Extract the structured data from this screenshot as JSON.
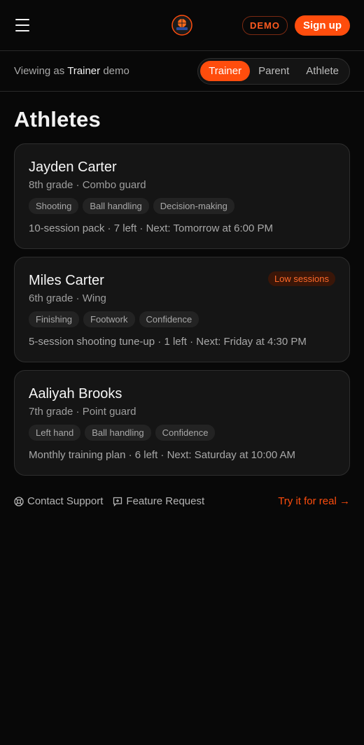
{
  "header": {
    "demo_label": "DEMO",
    "signup_label": "Sign up"
  },
  "viewbar": {
    "prefix": "Viewing as",
    "role": "Trainer",
    "suffix": "demo",
    "roles": [
      "Trainer",
      "Parent",
      "Athlete"
    ]
  },
  "page": {
    "title": "Athletes"
  },
  "athletes": [
    {
      "name": "Jayden Carter",
      "sub": "8th grade · Combo guard",
      "tags": [
        "Shooting",
        "Ball handling",
        "Decision-making"
      ],
      "meta": "10-session pack · 7 left · Next: Tomorrow at 6:00 PM",
      "badge": ""
    },
    {
      "name": "Miles Carter",
      "sub": "6th grade · Wing",
      "tags": [
        "Finishing",
        "Footwork",
        "Confidence"
      ],
      "meta": "5-session shooting tune-up · 1 left · Next: Friday at 4:30 PM",
      "badge": "Low sessions"
    },
    {
      "name": "Aaliyah Brooks",
      "sub": "7th grade · Point guard",
      "tags": [
        "Left hand",
        "Ball handling",
        "Confidence"
      ],
      "meta": "Monthly training plan · 6 left · Next: Saturday at 10:00 AM",
      "badge": ""
    }
  ],
  "footer": {
    "support_label": "Contact Support",
    "feature_label": "Feature Request",
    "try_label": "Try it for real →"
  },
  "colors": {
    "accent": "#ff4d0d",
    "background": "#080808",
    "card": "#151515"
  }
}
